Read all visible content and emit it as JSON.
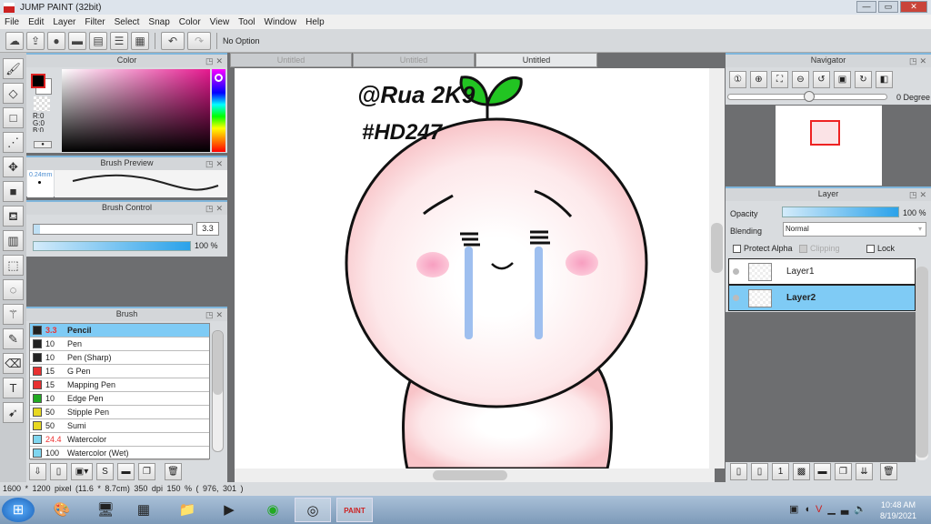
{
  "window": {
    "title": "JUMP PAINT (32bit)",
    "controls": [
      "—",
      "▭",
      "✕"
    ]
  },
  "menu": [
    "File",
    "Edit",
    "Layer",
    "Filter",
    "Select",
    "Snap",
    "Color",
    "View",
    "Tool",
    "Window",
    "Help"
  ],
  "toolbar": {
    "option_text": "No Option",
    "icons": [
      "cloud-icon",
      "share-icon",
      "comment-icon",
      "message-icon",
      "page-icon",
      "list-icon",
      "grid-edit-icon"
    ],
    "undo": "undo-icon",
    "redo": "redo-icon"
  },
  "tools": [
    "brush",
    "eraser",
    "rectangle",
    "dot-line",
    "move",
    "fill-square",
    "bucket",
    "gradient",
    "rect-select",
    "lasso-select",
    "magic-wand",
    "select-pen",
    "select-eraser",
    "text",
    "selection-cursor"
  ],
  "color_panel": {
    "title": "Color",
    "r": "R:0",
    "g": "G:0",
    "b": "B:0",
    "hue_color": "#ff1fa8"
  },
  "brush_preview": {
    "title": "Brush Preview",
    "size": "0.24mm"
  },
  "brush_control": {
    "title": "Brush Control",
    "size": "3.3",
    "opacity": "100 %",
    "opacity_value": 100
  },
  "brush_panel": {
    "title": "Brush",
    "items": [
      {
        "size": "3.3",
        "name": "Pencil",
        "color": "#222222",
        "selected": true,
        "size_red": true
      },
      {
        "size": "10",
        "name": "Pen",
        "color": "#222222"
      },
      {
        "size": "10",
        "name": "Pen (Sharp)",
        "color": "#222222"
      },
      {
        "size": "15",
        "name": "G Pen",
        "color": "#e83030"
      },
      {
        "size": "15",
        "name": "Mapping Pen",
        "color": "#e83030"
      },
      {
        "size": "10",
        "name": "Edge Pen",
        "color": "#22aa22"
      },
      {
        "size": "50",
        "name": "Stipple Pen",
        "color": "#e8d820"
      },
      {
        "size": "50",
        "name": "Sumi",
        "color": "#e8d820"
      },
      {
        "size": "24.4",
        "name": "Watercolor",
        "color": "#7fd6f0",
        "size_red": true
      },
      {
        "size": "100",
        "name": "Watercolor (Wet)",
        "color": "#7fd6f0"
      }
    ]
  },
  "tabs": [
    "Untitled",
    "Untitled",
    "Untitled"
  ],
  "artwork": {
    "line1": "@Rua 2K9",
    "line2": "#HD247"
  },
  "navigator": {
    "title": "Navigator",
    "degree": "0 Degree"
  },
  "layer_panel": {
    "title": "Layer",
    "opacity_label": "Opacity",
    "opacity": "100 %",
    "opacity_value": 100,
    "blending_label": "Blending",
    "blending": "Normal",
    "protect_alpha": "Protect Alpha",
    "clipping": "Clipping",
    "lock": "Lock",
    "layers": [
      {
        "name": "Layer1",
        "selected": false
      },
      {
        "name": "Layer2",
        "selected": true
      }
    ]
  },
  "status": "1600 * 1200 pixel  (11.6 * 8.7cm)  350 dpi  150 %  ( 976, 301 )",
  "taskbar": {
    "time": "10:48 AM",
    "date": "8/19/2021"
  }
}
